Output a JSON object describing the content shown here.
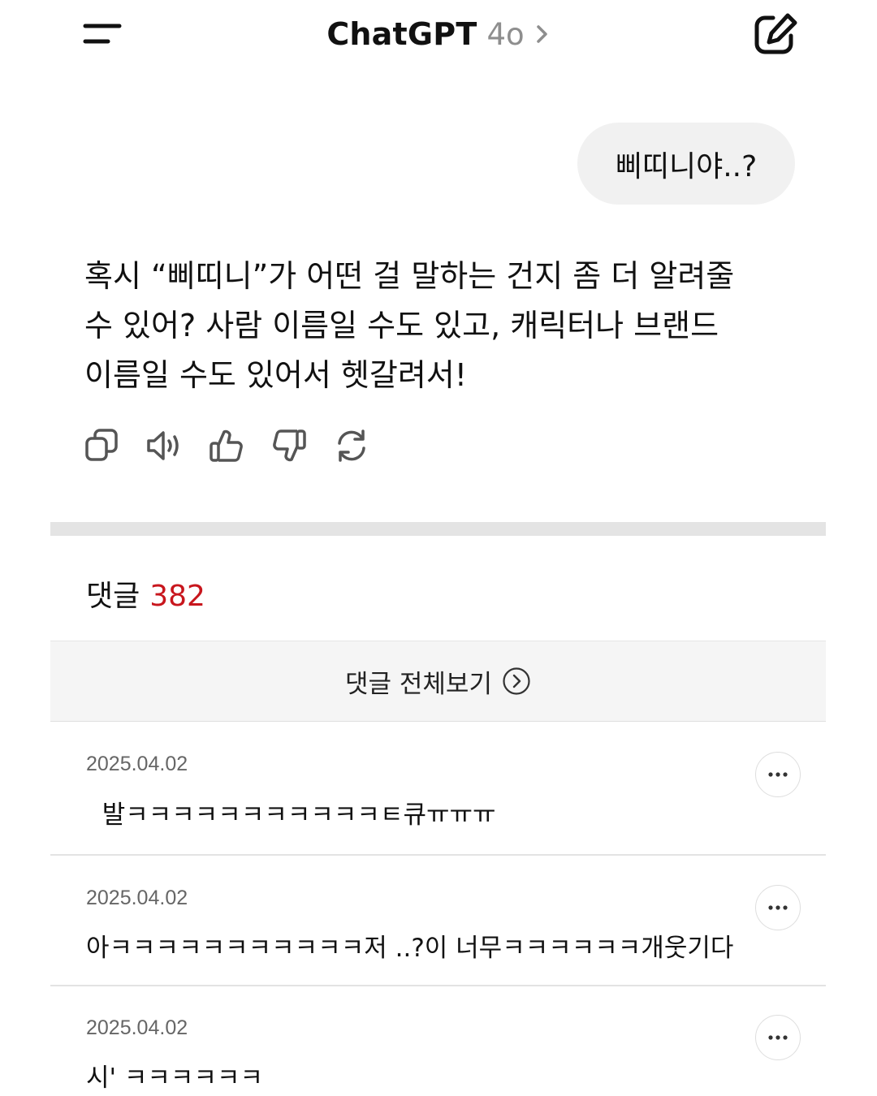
{
  "header": {
    "title": "ChatGPT",
    "model": "4o",
    "menu_icon": "menu-icon",
    "chevron_icon": "chevron-right-icon",
    "edit_icon": "new-chat-icon"
  },
  "user_message": "삐띠니야..?",
  "assistant_message": {
    "lines": [
      "혹시 “삐띠니”가 어떤 걸 말하는 건지 좀 더 알려줄",
      "수 있어? 사람 이름일 수도 있고, 캐릭터나 브랜드",
      "이름일 수도 있어서 헷갈려서!"
    ],
    "actions": [
      "copy-icon",
      "read-aloud-icon",
      "thumbs-up-icon",
      "thumbs-down-icon",
      "regenerate-icon"
    ]
  },
  "comments": {
    "label": "댓글",
    "count": "382",
    "count_color": "#c8161d",
    "view_all_label": "댓글 전체보기",
    "items": [
      {
        "date": "2025.04.02",
        "text": "  발ㅋㅋㅋㅋㅋㅋㅋㅋㅋㅋㅋㅌ큐ㅠㅠㅠ"
      },
      {
        "date": "2025.04.02",
        "text": "아ㅋㅋㅋㅋㅋㅋㅋㅋㅋㅋㅋ저 ..?이 너무ㅋㅋㅋㅋㅋㅋ개웃기다"
      },
      {
        "date": "2025.04.02",
        "text": "시' ㅋㅋㅋㅋㅋㅋ"
      }
    ]
  }
}
